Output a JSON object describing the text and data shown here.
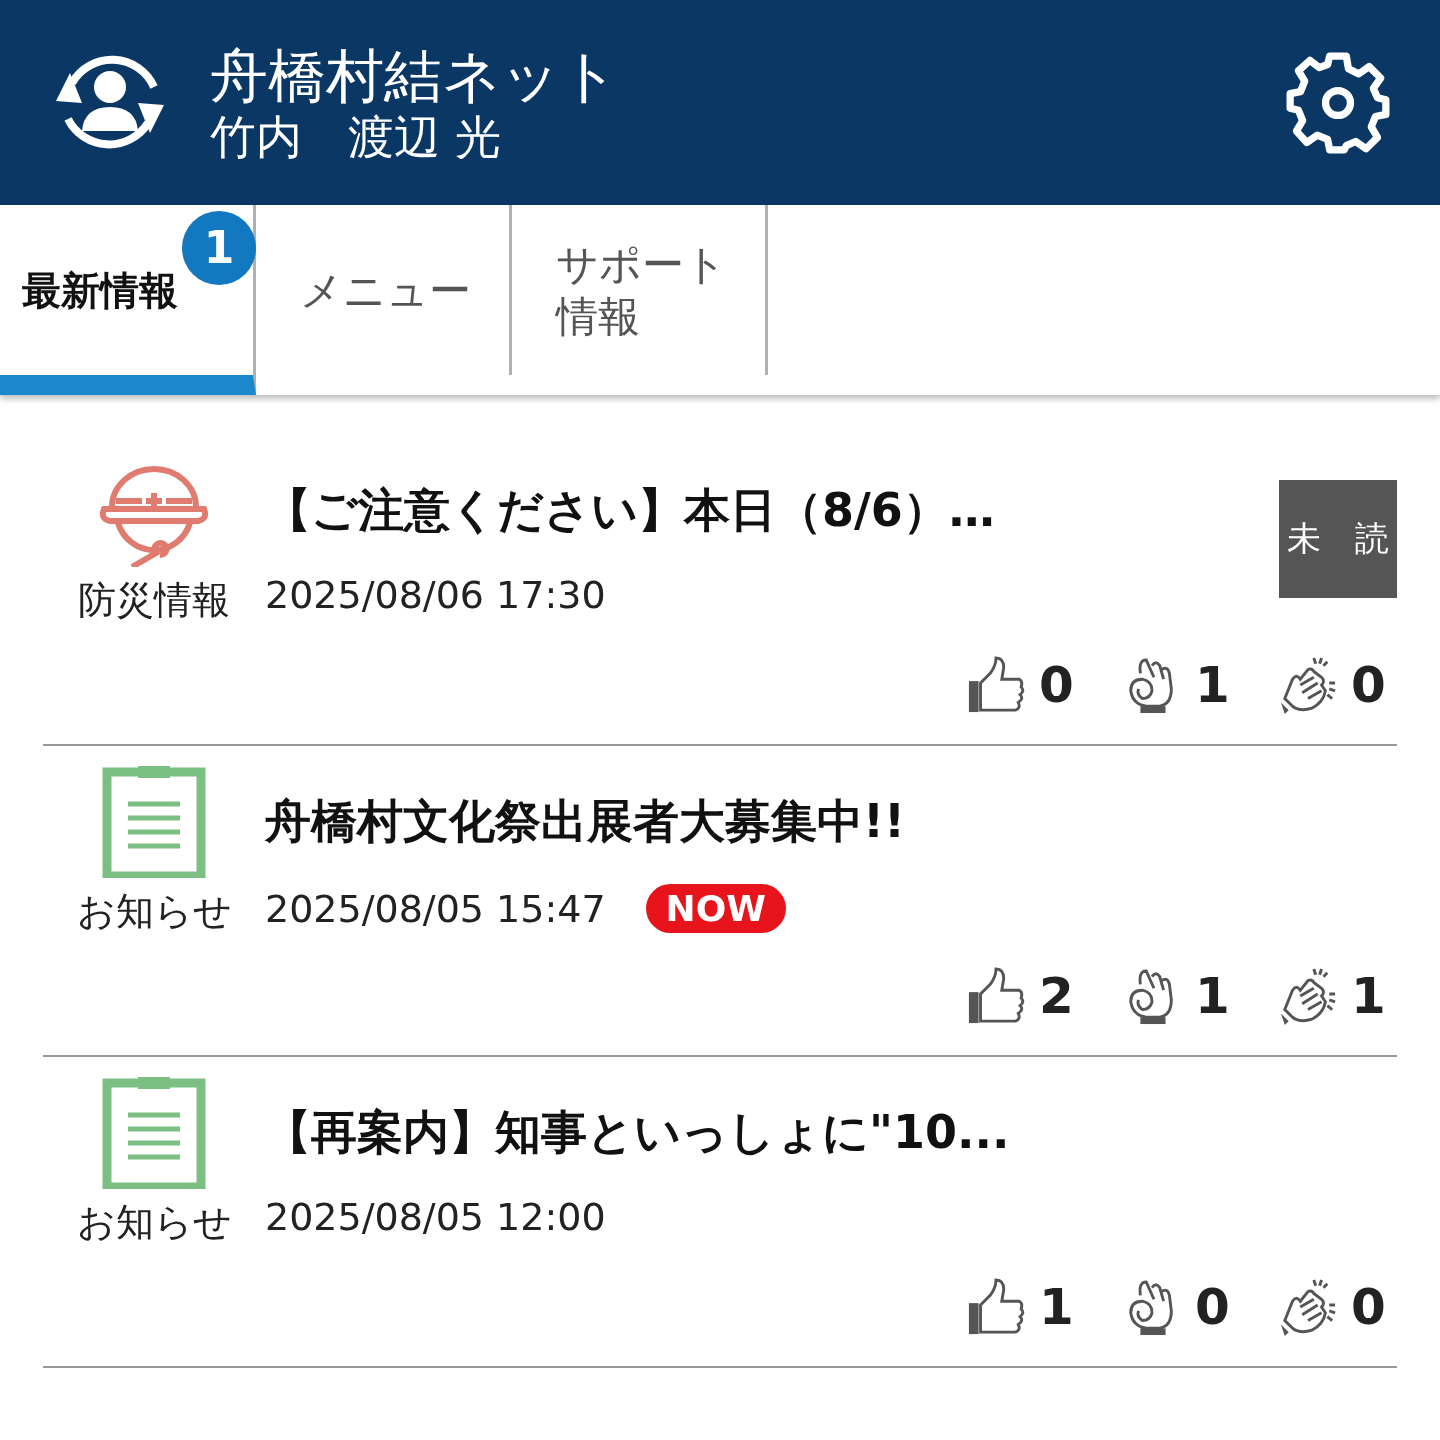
{
  "header": {
    "title": "舟橋村結ネット",
    "user": "竹内　渡辺 光"
  },
  "tabs": [
    {
      "label": "最新情報",
      "selected": true,
      "badge": "1"
    },
    {
      "label": "メニュー",
      "selected": false
    },
    {
      "label": "サポート情報",
      "selected": false
    }
  ],
  "posts": [
    {
      "kind": "disaster",
      "category": "防災情報",
      "title": "【ご注意ください】本日（8/6）…",
      "date": "2025/08/06 17:30",
      "unread_label": "未　読",
      "reactions": [
        {
          "kind": "like",
          "count": "0"
        },
        {
          "kind": "ok",
          "count": "1"
        },
        {
          "kind": "clap",
          "count": "0"
        }
      ]
    },
    {
      "kind": "notice",
      "category": "お知らせ",
      "title": "舟橋村文化祭出展者大募集中!!",
      "date": "2025/08/05 15:47",
      "badge": "NOW",
      "reactions": [
        {
          "kind": "like",
          "count": "2"
        },
        {
          "kind": "ok",
          "count": "1"
        },
        {
          "kind": "clap",
          "count": "1"
        }
      ]
    },
    {
      "kind": "notice",
      "category": "お知らせ",
      "title": "【再案内】知事といっしょに\"10...",
      "date": "2025/08/05 12:00",
      "reactions": [
        {
          "kind": "like",
          "count": "1"
        },
        {
          "kind": "ok",
          "count": "0"
        },
        {
          "kind": "clap",
          "count": "0"
        }
      ]
    }
  ]
}
